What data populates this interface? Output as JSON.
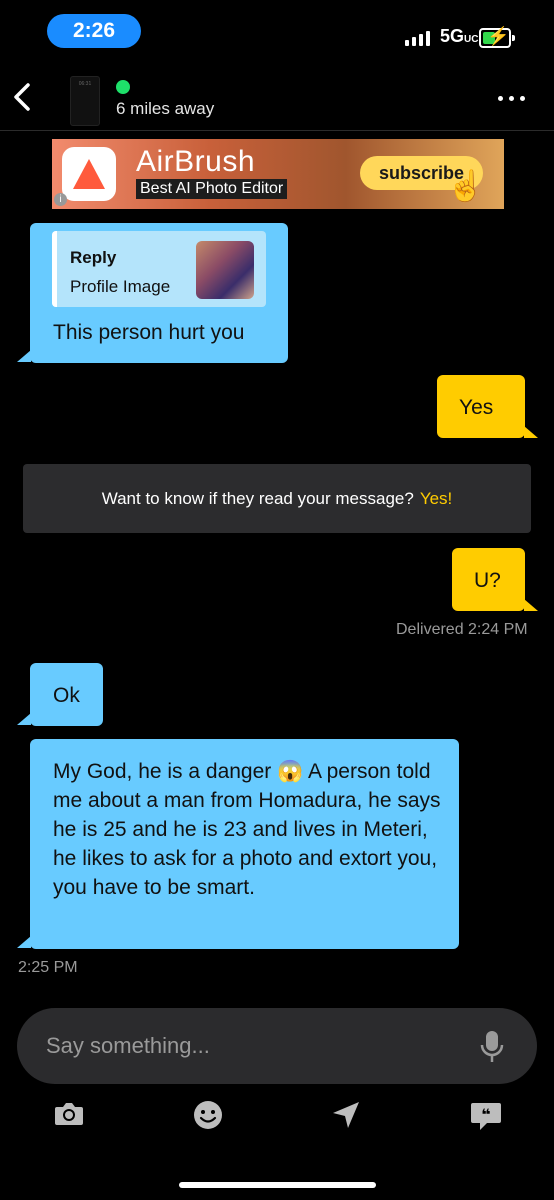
{
  "status_bar": {
    "time": "2:26",
    "network": "5G",
    "network_suffix": "UC"
  },
  "header": {
    "distance": "6 miles away",
    "thumbnail_text": "06:31"
  },
  "ad": {
    "title": "AirBrush",
    "subtitle": "Best AI Photo Editor",
    "button_label": "subscribe",
    "info_glyph": "i"
  },
  "messages": {
    "reply_preview": {
      "label": "Reply",
      "sub": "Profile Image"
    },
    "m1": "This person hurt you",
    "m2": "Yes",
    "banner_text": "Want to know if they read your message?",
    "banner_yes": "Yes!",
    "m3": "U?",
    "delivered": "Delivered 2:24 PM",
    "m4": "Ok",
    "m5": "My God, he is a danger 😱 A person told me about a man from Homadura, he says he is 25 and he is 23 and lives in Meteri, he likes to ask for a photo and extort you, you have to be smart.",
    "m5_time": "2:25 PM"
  },
  "composer": {
    "placeholder": "Say something..."
  },
  "toolbar": {
    "icons": [
      "camera-icon",
      "emoji-icon",
      "location-icon",
      "saved-phrases-icon"
    ]
  },
  "colors": {
    "incoming": "#68cbff",
    "outgoing": "#ffcc00",
    "online": "#1ee06a",
    "status_pill": "#1a8cff"
  }
}
